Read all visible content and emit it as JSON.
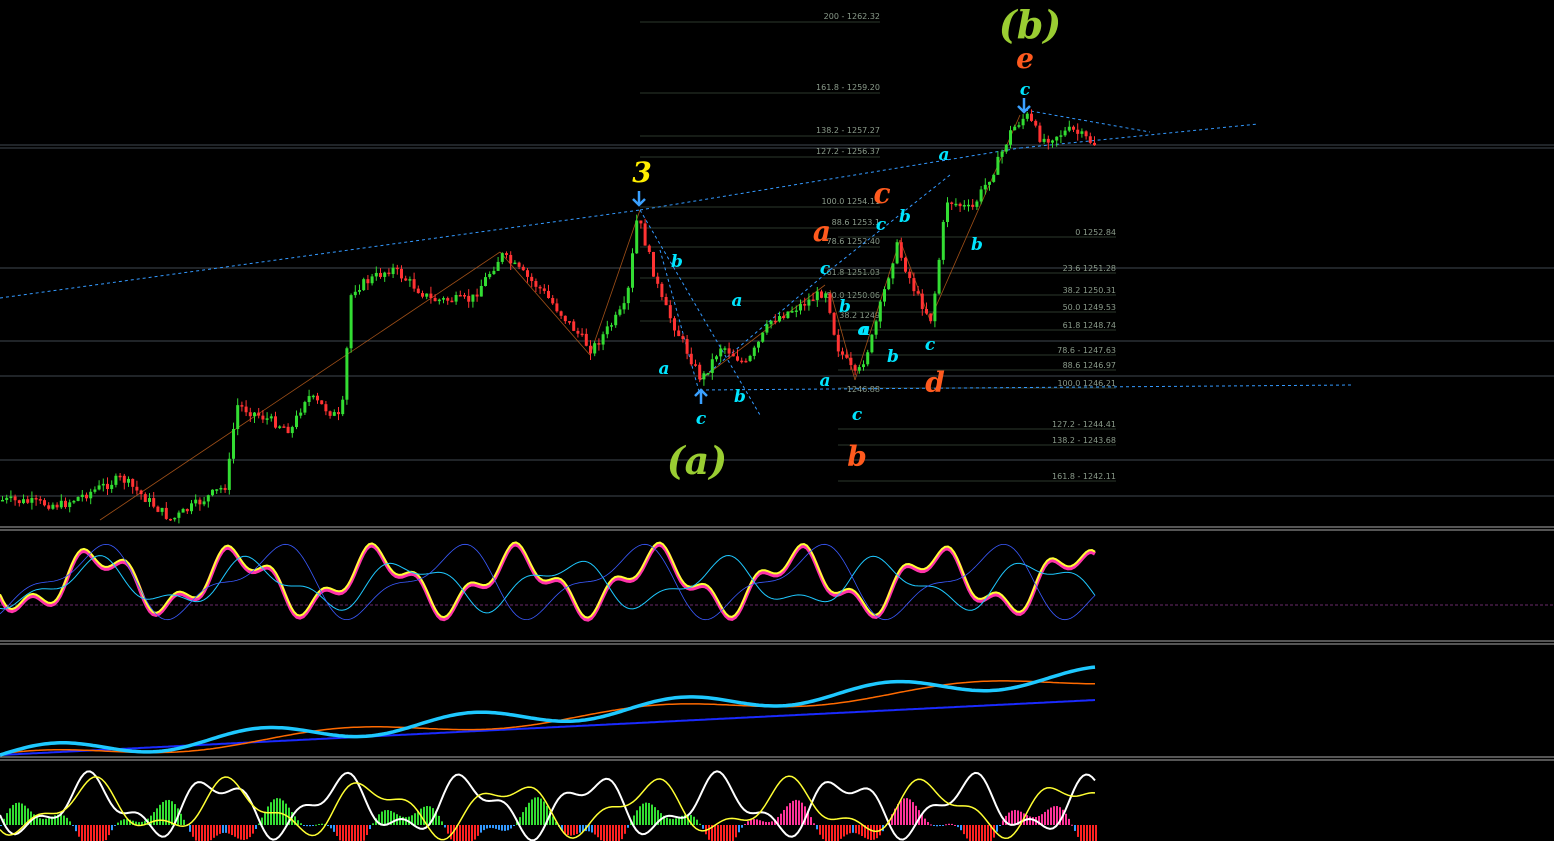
{
  "chart_data": {
    "type": "candlestick",
    "title": "",
    "colors": {
      "up": "#33dd33",
      "down": "#ff3333",
      "fib_line": "#3a4a3a",
      "trend_dotted": "#3399ff",
      "wave_cyan": "#00e5ff",
      "wave_orange": "#ff5a1e",
      "wave_green": "#9acd32",
      "wave_yellow": "#ffee00",
      "osc_yellow": "#ffff33",
      "osc_magenta": "#ff33aa",
      "osc_blue": "#1ec8ff",
      "osc_darkblue": "#1a2aff",
      "osc_orange": "#ff6a00"
    },
    "fib_upper": [
      {
        "label": "200 - 1262.32",
        "price": 1262.32
      },
      {
        "label": "161.8 - 1259.20",
        "price": 1259.2
      },
      {
        "label": "138.2 - 1257.27",
        "price": 1257.27
      },
      {
        "label": "127.2 - 1256.37",
        "price": 1256.37
      },
      {
        "label": "100.0 1254.11",
        "price": 1254.11
      },
      {
        "label": "88.6 1253.1",
        "price": 1253.1
      },
      {
        "label": "78.6 1252.40",
        "price": 1252.4
      },
      {
        "label": "61.8 1251.03",
        "price": 1251.03
      },
      {
        "label": "50.0 1250.06",
        "price": 1250.06
      },
      {
        "label": "38.2 1249",
        "price": 1249
      }
    ],
    "fib_right": [
      {
        "label": "0 1252.84",
        "price": 1252.84
      },
      {
        "label": "23.6 1251.28",
        "price": 1251.28
      },
      {
        "label": "38.2 1250.31",
        "price": 1250.31
      },
      {
        "label": "50.0 1249.53",
        "price": 1249.53
      },
      {
        "label": "61.8 1248.74",
        "price": 1248.74
      },
      {
        "label": "78.6 - 1247.63",
        "price": 1247.63
      },
      {
        "label": "88.6 1246.97",
        "price": 1246.97
      },
      {
        "label": "100.0 1246.21",
        "price": 1246.21
      },
      {
        "label": "127.2 - 1244.41",
        "price": 1244.41
      },
      {
        "label": "138.2 - 1243.68",
        "price": 1243.68
      },
      {
        "label": "161.8 - 1242.11",
        "price": 1242.11
      }
    ],
    "fib_low_label": "1246.88",
    "wave_labels": [
      {
        "text": "(b)",
        "color": "#9acd32",
        "size": "xl"
      },
      {
        "text": "e",
        "color": "#ff5a1e",
        "size": "l"
      },
      {
        "text": "c",
        "color": "#00e5ff",
        "size": "m"
      },
      {
        "text": "3",
        "color": "#ffee00",
        "size": "l"
      },
      {
        "text": "a",
        "color": "#00e5ff",
        "size": "m"
      },
      {
        "text": "c",
        "color": "#ff5a1e",
        "size": "l"
      },
      {
        "text": "b",
        "color": "#00e5ff",
        "size": "m"
      },
      {
        "text": "a",
        "color": "#ff5a1e",
        "size": "l"
      },
      {
        "text": "b",
        "color": "#00e5ff",
        "size": "m"
      },
      {
        "text": "c",
        "color": "#00e5ff",
        "size": "m"
      },
      {
        "text": "b",
        "color": "#00e5ff",
        "size": "m"
      },
      {
        "text": "a",
        "color": "#00e5ff",
        "size": "m"
      },
      {
        "text": "c",
        "color": "#00e5ff",
        "size": "m"
      },
      {
        "text": "b",
        "color": "#00e5ff",
        "size": "m"
      },
      {
        "text": "a",
        "color": "#00e5ff",
        "size": "m"
      },
      {
        "text": "b",
        "color": "#00e5ff",
        "size": "m"
      },
      {
        "text": "a",
        "color": "#00e5ff",
        "size": "m"
      },
      {
        "text": "c",
        "color": "#00e5ff",
        "size": "m"
      },
      {
        "text": "d",
        "color": "#ff5a1e",
        "size": "l"
      },
      {
        "text": "a",
        "color": "#00e5ff",
        "size": "m"
      },
      {
        "text": "b",
        "color": "#00e5ff",
        "size": "m"
      },
      {
        "text": "a",
        "color": "#00e5ff",
        "size": "m"
      },
      {
        "text": "c",
        "color": "#00e5ff",
        "size": "m"
      },
      {
        "text": "c",
        "color": "#00e5ff",
        "size": "m"
      },
      {
        "text": "(a)",
        "color": "#9acd32",
        "size": "xl"
      },
      {
        "text": "b",
        "color": "#ff5a1e",
        "size": "l"
      }
    ]
  }
}
